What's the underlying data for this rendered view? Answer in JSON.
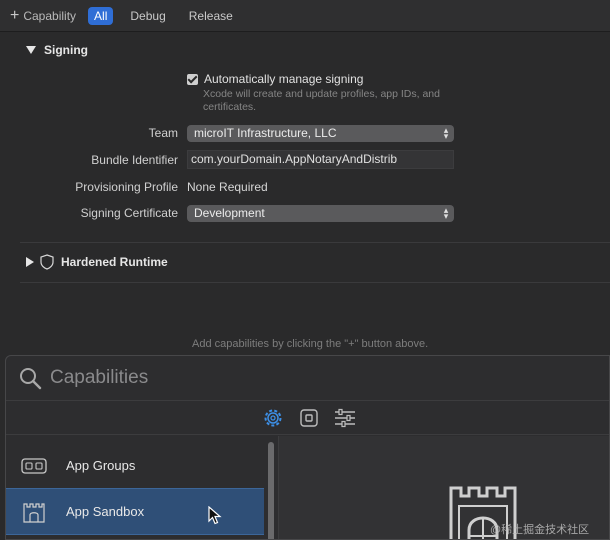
{
  "topbar": {
    "add_capability": "Capability",
    "filters": [
      "All",
      "Debug",
      "Release"
    ],
    "active_filter": "All"
  },
  "signing": {
    "title": "Signing",
    "auto_manage_label": "Automatically manage signing",
    "auto_manage_checked": true,
    "auto_manage_note": "Xcode will create and update profiles, app IDs, and certificates.",
    "team_label": "Team",
    "team_value": "microIT Infrastructure, LLC",
    "bundle_id_label": "Bundle Identifier",
    "bundle_id_value": "com.yourDomain.AppNotaryAndDistrib",
    "provisioning_label": "Provisioning Profile",
    "provisioning_value": "None Required",
    "certificate_label": "Signing Certificate",
    "certificate_value": "Development"
  },
  "hardened_runtime": {
    "title": "Hardened Runtime"
  },
  "hint": "Add capabilities by clicking the \"+\" button above.",
  "library": {
    "search_placeholder": "Capabilities",
    "toolbar_icons": [
      "gear-icon",
      "square-icon",
      "sliders-icon"
    ],
    "items": [
      {
        "label": "App Groups",
        "icon": "app-groups-icon",
        "selected": false
      },
      {
        "label": "App Sandbox",
        "icon": "app-sandbox-icon",
        "selected": true
      }
    ]
  },
  "watermark": "@稀土掘金技术社区",
  "colors": {
    "accent": "#2f6ed6",
    "selected_row": "#2f4f77",
    "background": "#2a2a2b"
  }
}
